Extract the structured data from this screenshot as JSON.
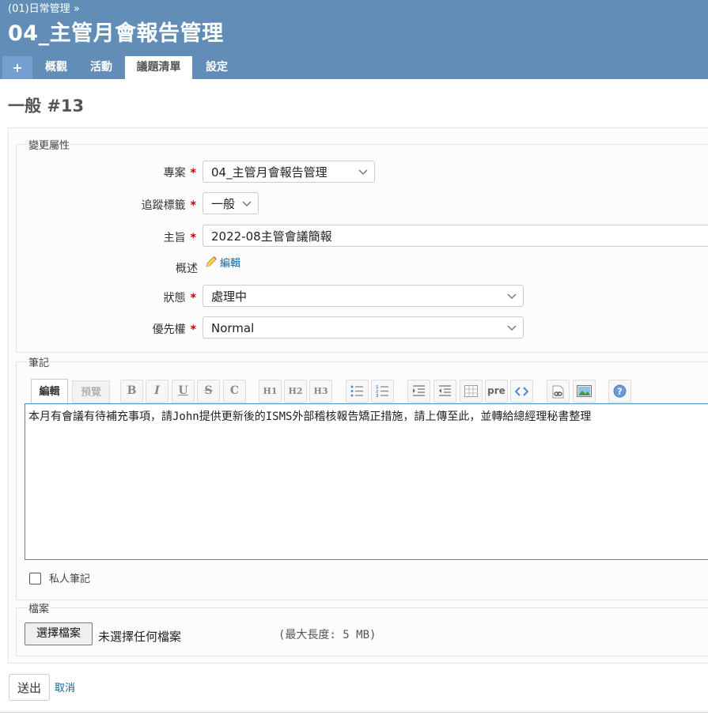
{
  "header": {
    "parent_link": "(01)日常管理 »",
    "project_title": "04_主管月會報告管理"
  },
  "main_menu": {
    "new_label": "+",
    "tabs": [
      {
        "label": "概觀"
      },
      {
        "label": "活動"
      },
      {
        "label": "議題清單",
        "selected": true
      },
      {
        "label": "設定"
      }
    ]
  },
  "page": {
    "heading": "一般 #13"
  },
  "attributes": {
    "legend": "變更屬性",
    "required_mark": "*",
    "project": {
      "label": "專案",
      "value": "04_主管月會報告管理"
    },
    "tracker": {
      "label": "追蹤標籤",
      "value": "一般"
    },
    "subject": {
      "label": "主旨",
      "value": "2022-08主管會議簡報"
    },
    "description": {
      "label": "概述",
      "edit_label": "編輯"
    },
    "status": {
      "label": "狀態",
      "value": "處理中"
    },
    "priority": {
      "label": "優先權",
      "value": "Normal"
    }
  },
  "notes": {
    "legend": "筆記",
    "edit_tab": "編輯",
    "preview_tab": "預覽",
    "toolbar": {
      "bold": "B",
      "italic": "I",
      "underline": "U",
      "strike": "S",
      "code": "C",
      "h1": "H1",
      "h2": "H2",
      "h3": "H3",
      "pre": "pre"
    },
    "content": "本月有會議有待補充事項，請John提供更新後的ISMS外部稽核報告矯正措施，請上傳至此，並轉給總經理秘書整理",
    "private_label": "私人筆記",
    "private_checked": false
  },
  "files": {
    "legend": "檔案",
    "choose_button": "選擇檔案",
    "no_file_text": "未選擇任何檔案",
    "max_size_text": "(最大長度: 5 MB)"
  },
  "actions": {
    "submit": "送出",
    "cancel": "取消"
  },
  "colors": {
    "header_bg": "#628db6",
    "required": "#bb0000",
    "link": "#116699"
  }
}
